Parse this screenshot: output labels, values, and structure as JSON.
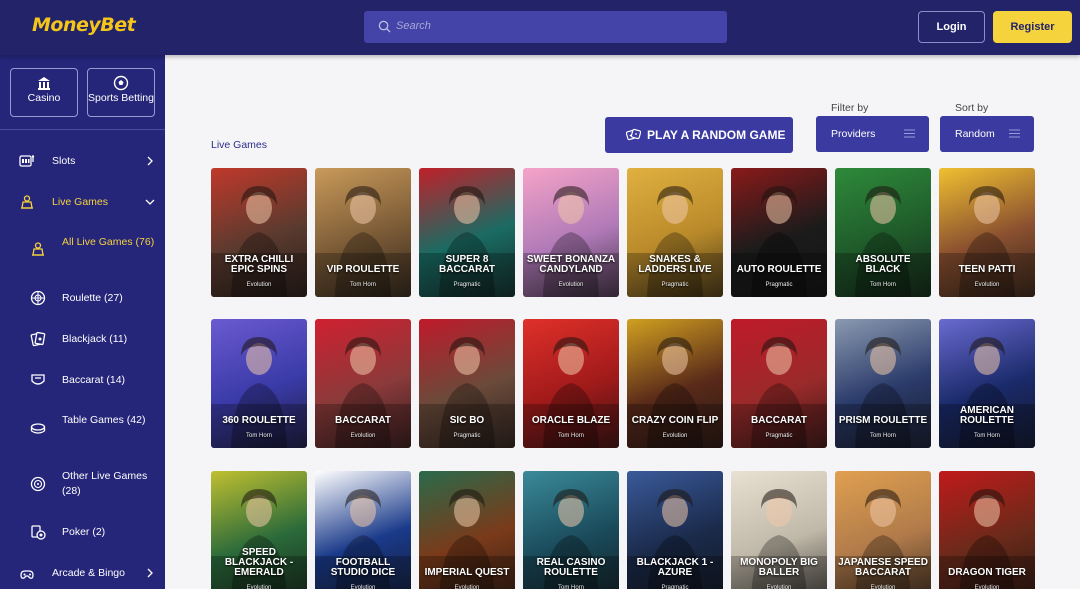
{
  "header": {
    "logo_text": "MoneyBet",
    "search_placeholder": "Search",
    "login_label": "Login",
    "register_label": "Register"
  },
  "sidebar": {
    "casino_label": "Casino",
    "sports_label": "Sports Betting",
    "items": [
      {
        "label": "Slots",
        "icon": "slots-icon"
      },
      {
        "label": "Live Games",
        "icon": "live-games-icon"
      },
      {
        "label": "All Live Games (76)",
        "icon": "all-live-games-icon"
      },
      {
        "label": "Roulette (27)",
        "icon": "roulette-icon"
      },
      {
        "label": "Blackjack (11)",
        "icon": "blackjack-icon"
      },
      {
        "label": "Baccarat (14)",
        "icon": "baccarat-icon"
      },
      {
        "label": "Table Games (42)",
        "icon": "table-games-icon"
      },
      {
        "label": "Other Live Games (28)",
        "icon": "other-live-games-icon"
      },
      {
        "label": "Poker (2)",
        "icon": "poker-icon"
      },
      {
        "label": "Arcade & Bingo",
        "icon": "arcade-bingo-icon"
      }
    ]
  },
  "main": {
    "section_title": "Live Games",
    "random_button": "PLAY A RANDOM GAME",
    "filter_label": "Filter by",
    "filter_value": "Providers",
    "sort_label": "Sort by",
    "sort_value": "Random"
  },
  "games": [
    {
      "name": "EXTRA CHILLI EPIC SPINS",
      "provider": "Evolution",
      "bg": "#5a3a2e",
      "accent": "#c0392b"
    },
    {
      "name": "VIP ROULETTE",
      "provider": "Tom Horn",
      "bg": "#7a5a36",
      "accent": "#c99a5a"
    },
    {
      "name": "SUPER 8 BACCARAT",
      "provider": "Pragmatic",
      "bg": "#1a6b63",
      "accent": "#c0202a"
    },
    {
      "name": "SWEET BONANZA CANDYLAND",
      "provider": "Evolution",
      "bg": "#b07ab8",
      "accent": "#f5a3c7"
    },
    {
      "name": "SNAKES & LADDERS LIVE",
      "provider": "Pragmatic",
      "bg": "#b98a2a",
      "accent": "#e0b040"
    },
    {
      "name": "AUTO ROULETTE",
      "provider": "Pragmatic",
      "bg": "#1b1b1b",
      "accent": "#8a1a1a"
    },
    {
      "name": "ABSOLUTE BLACK",
      "provider": "Tom Horn",
      "bg": "#1f5a2a",
      "accent": "#2e8a3a"
    },
    {
      "name": "TEEN PATTI",
      "provider": "Evolution",
      "bg": "#8a5030",
      "accent": "#f0c030"
    },
    {
      "name": "360 ROULETTE",
      "provider": "Tom Horn",
      "bg": "#3a3aa8",
      "accent": "#6a5ad0"
    },
    {
      "name": "BACCARAT",
      "provider": "Evolution",
      "bg": "#8a3a3a",
      "accent": "#d02030"
    },
    {
      "name": "SIC BO",
      "provider": "Pragmatic",
      "bg": "#6a4a3a",
      "accent": "#c01a2a"
    },
    {
      "name": "ORACLE BLAZE",
      "provider": "Tom Horn",
      "bg": "#a01a1a",
      "accent": "#e0302a"
    },
    {
      "name": "CRAZY COIN FLIP",
      "provider": "Evolution",
      "bg": "#5a2a1a",
      "accent": "#d0a020"
    },
    {
      "name": "BACCARAT",
      "provider": "Pragmatic",
      "bg": "#9a2a2a",
      "accent": "#c01a2a"
    },
    {
      "name": "PRISM ROULETTE",
      "provider": "Tom Horn",
      "bg": "#2a3a6a",
      "accent": "#8a9ab0"
    },
    {
      "name": "AMERICAN ROULETTE",
      "provider": "Tom Horn",
      "bg": "#1a2a6a",
      "accent": "#6a6ad0"
    },
    {
      "name": "SPEED BLACKJACK - EMERALD",
      "provider": "Evolution",
      "bg": "#2a6a3a",
      "accent": "#c0c030"
    },
    {
      "name": "FOOTBALL STUDIO DICE",
      "provider": "Evolution",
      "bg": "#1a3a8a",
      "accent": "#ffffff"
    },
    {
      "name": "IMPERIAL QUEST",
      "provider": "Evolution",
      "bg": "#7a3a1a",
      "accent": "#2a6a4a"
    },
    {
      "name": "REAL CASINO ROULETTE",
      "provider": "Tom Horn",
      "bg": "#1a4a5a",
      "accent": "#3a8a9a"
    },
    {
      "name": "BLACKJACK 1 - AZURE",
      "provider": "Pragmatic",
      "bg": "#1a2a4a",
      "accent": "#3a5a9a"
    },
    {
      "name": "MONOPOLY BIG BALLER",
      "provider": "Evolution",
      "bg": "#c0b8a8",
      "accent": "#e8e0d0"
    },
    {
      "name": "JAPANESE SPEED BACCARAT",
      "provider": "Evolution",
      "bg": "#b07a4a",
      "accent": "#e0a050"
    },
    {
      "name": "DRAGON TIGER",
      "provider": "Evolution",
      "bg": "#6a2a1a",
      "accent": "#c01a1a"
    }
  ]
}
